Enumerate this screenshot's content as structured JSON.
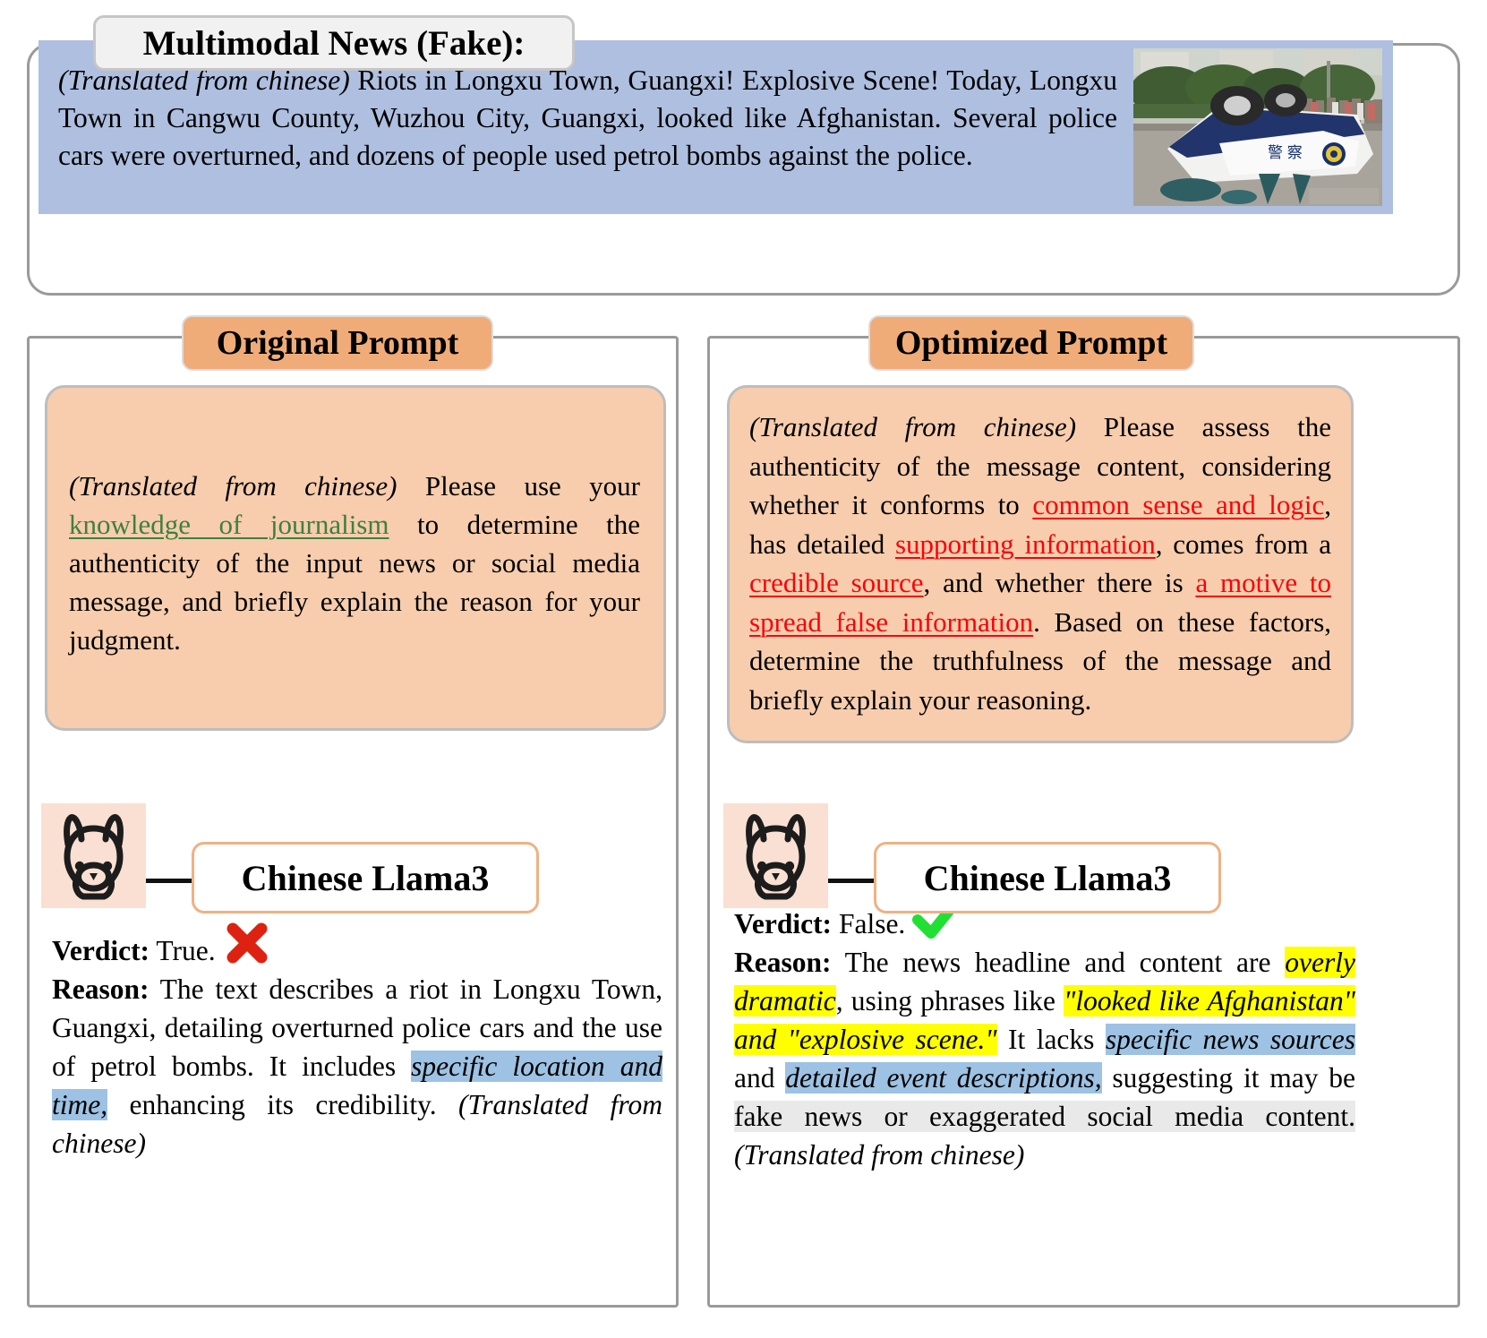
{
  "news": {
    "title": "Multimodal News (Fake):",
    "translation_note": "(Translated from chinese)",
    "body": " Riots in Longxu Town, Guangxi! Explosive Scene! Today, Longxu Town in Cangwu County, Wuzhou City, Guangxi, looked like Afghanistan. Several police cars were overturned, and dozens of people used petrol bombs against the police.",
    "image_alt": "overturned-police-car-photo"
  },
  "left": {
    "header_label": "Original Prompt",
    "model_label": "Chinese Llama3",
    "prompt": {
      "translation_note": "(Translated from chinese)",
      "part1": " Please use your ",
      "highlight_green": "knowledge of journalism",
      "part2": " to determine the authenticity of the input news or social media message, and briefly explain the reason for your judgment."
    },
    "verdict_label": "Verdict:",
    "verdict_value": "True.",
    "verdict_icon": "red-cross-icon",
    "reason_label": "Reason:",
    "reason": {
      "part1": " The text describes a riot in Longxu Town, Guangxi, detailing overturned police cars and the use of petrol bombs. It includes ",
      "highlight_blue": "specific location and time,",
      "part2": " enhancing its credibility. ",
      "translation_note": "(Translated from chinese)"
    }
  },
  "right": {
    "header_label": "Optimized Prompt",
    "model_label": "Chinese Llama3",
    "prompt": {
      "translation_note": "(Translated from chinese)",
      "part1": " Please assess the authenticity of the message content, considering whether it conforms to ",
      "red1": "common sense and logic",
      "part2": ", has detailed ",
      "red2": "supporting information",
      "part3": ", comes from a ",
      "red3": "credible source",
      "part4": ", and whether there is ",
      "red4": "a motive to spread false information",
      "part5": ". Based on these factors, determine the truthfulness of the message and briefly explain your reasoning."
    },
    "verdict_label": "Verdict:",
    "verdict_value": "False.",
    "verdict_icon": "green-check-icon",
    "reason_label": "Reason:",
    "reason": {
      "part1": " The news headline and content are ",
      "yellow1": "overly dramatic",
      "part2": ", using phrases like ",
      "yellow2": "\"looked like Afghanistan\" and \"explosive scene.\"",
      "part3": " It lacks ",
      "blue1": "specific news sources",
      "part4": " and ",
      "blue2": "detailed event descriptions,",
      "part5": " suggesting it may be ",
      "grey1": "fake news or exaggerated social media content.",
      "translation_note": "(Translated from chinese)"
    }
  },
  "colors": {
    "news_bg": "#aebfe0",
    "prompt_bg": "#f7cdad",
    "chip_orange": "#f0ac78",
    "green_underline": "#3f7f3f",
    "red_underline": "#fb0008",
    "highlight_blue": "#9dc2e3",
    "highlight_yellow": "#ffff00",
    "highlight_grey": "#e9e9e9",
    "cross_red": "#dd2211",
    "check_green": "#22e033"
  }
}
